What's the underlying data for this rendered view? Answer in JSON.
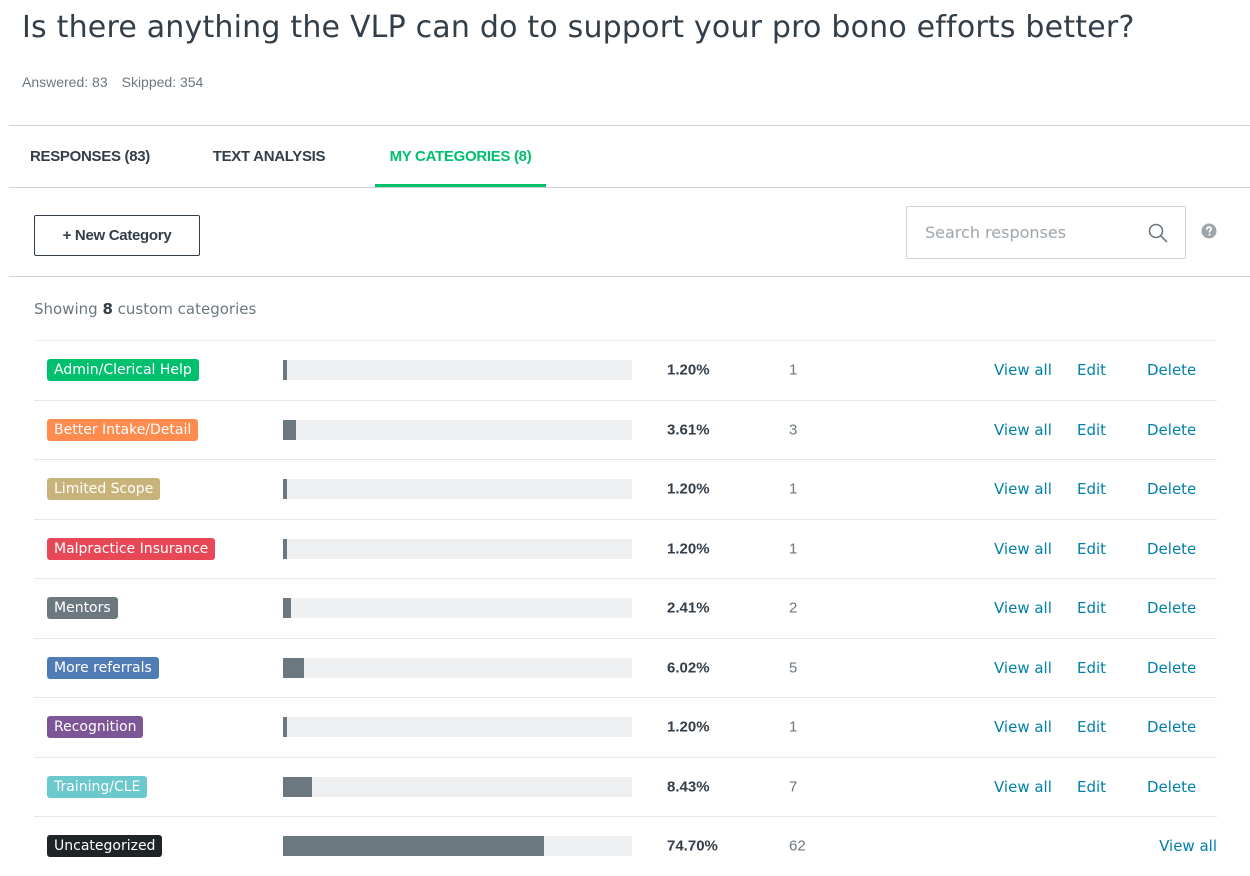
{
  "question": {
    "title": "Is there anything the VLP can do to support your pro bono efforts better?",
    "answered": "Answered: 83",
    "skipped": "Skipped: 354"
  },
  "tabs": [
    {
      "label": "RESPONSES (83)",
      "active": false
    },
    {
      "label": "TEXT ANALYSIS",
      "active": false
    },
    {
      "label": "MY CATEGORIES (8)",
      "active": true
    }
  ],
  "toolbar": {
    "new_category_label": "+ New Category",
    "search_placeholder": "Search responses",
    "search_icon": "search-icon",
    "help_icon": "question-circle-icon"
  },
  "summary": {
    "prefix": "Showing",
    "count": "8",
    "suffix": "custom categories"
  },
  "accent_color": "#00bf6f",
  "link_color": "#007faa",
  "categories": [
    {
      "name": "Admin/Clerical Help",
      "color": "#00bf6f",
      "percent_label": "1.20%",
      "percent": 1.2,
      "count": "1",
      "view_label": "View all",
      "edit_label": "Edit",
      "delete_label": "Delete"
    },
    {
      "name": "Better Intake/Detail",
      "color": "#ff8b4f",
      "percent_label": "3.61%",
      "percent": 3.61,
      "count": "3",
      "view_label": "View all",
      "edit_label": "Edit",
      "delete_label": "Delete"
    },
    {
      "name": "Limited Scope",
      "color": "#c8b47b",
      "percent_label": "1.20%",
      "percent": 1.2,
      "count": "1",
      "view_label": "View all",
      "edit_label": "Edit",
      "delete_label": "Delete"
    },
    {
      "name": "Malpractice Insurance",
      "color": "#e84856",
      "percent_label": "1.20%",
      "percent": 1.2,
      "count": "1",
      "view_label": "View all",
      "edit_label": "Edit",
      "delete_label": "Delete"
    },
    {
      "name": "Mentors",
      "color": "#6b787f",
      "percent_label": "2.41%",
      "percent": 2.41,
      "count": "2",
      "view_label": "View all",
      "edit_label": "Edit",
      "delete_label": "Delete"
    },
    {
      "name": "More referrals",
      "color": "#507cb6",
      "percent_label": "6.02%",
      "percent": 6.02,
      "count": "5",
      "view_label": "View all",
      "edit_label": "Edit",
      "delete_label": "Delete"
    },
    {
      "name": "Recognition",
      "color": "#7d5698",
      "percent_label": "1.20%",
      "percent": 1.2,
      "count": "1",
      "view_label": "View all",
      "edit_label": "Edit",
      "delete_label": "Delete"
    },
    {
      "name": "Training/CLE",
      "color": "#6bc8cd",
      "percent_label": "8.43%",
      "percent": 8.43,
      "count": "7",
      "view_label": "View all",
      "edit_label": "Edit",
      "delete_label": "Delete"
    },
    {
      "name": "Uncategorized",
      "color": "#1f2527",
      "percent_label": "74.70%",
      "percent": 74.7,
      "count": "62",
      "view_label": "View all"
    }
  ]
}
